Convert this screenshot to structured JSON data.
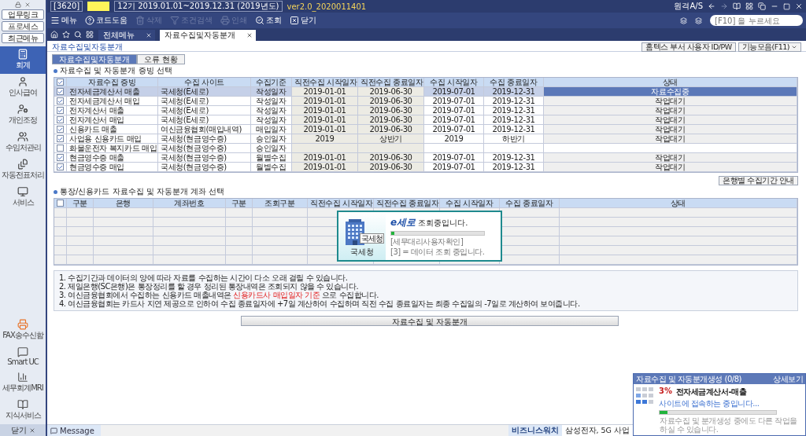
{
  "sidebar": {
    "top_buttons": [
      "업무링크",
      "프로세스",
      "최근메뉴"
    ],
    "items": [
      {
        "label": "회계",
        "selected": true
      },
      {
        "label": "인사급여",
        "selected": false
      },
      {
        "label": "개인조정",
        "selected": false
      },
      {
        "label": "수임처관리",
        "selected": false
      },
      {
        "label": "자동전표처리",
        "selected": false
      },
      {
        "label": "서비스",
        "selected": false
      }
    ],
    "bottom_items": [
      "FAX송수신함",
      "Smart UC",
      "세무회계MRI",
      "지식서비스"
    ],
    "close": "닫기"
  },
  "title_bar": {
    "code": "[3620]",
    "period": "12기 2019.01.01~2019.12.31 (2019년도)",
    "version": "ver2.0_2020011401",
    "remote": "원격A/S"
  },
  "toolbar": {
    "buttons": [
      {
        "label": "메뉴",
        "disabled": false
      },
      {
        "label": "코드도움",
        "disabled": false
      },
      {
        "label": "삭제",
        "disabled": true
      },
      {
        "label": "조건검색",
        "disabled": true
      },
      {
        "label": "인쇄",
        "disabled": true
      },
      {
        "label": "조회",
        "disabled": false
      },
      {
        "label": "닫기",
        "disabled": false
      }
    ],
    "search": {
      "placeholder": "[F10] 을 누르세요"
    }
  },
  "tabs": [
    {
      "label": "전체메뉴",
      "selected": false
    },
    {
      "label": "자료수집및자동분개",
      "selected": true
    }
  ],
  "page": {
    "title": "자료수집및자동분개",
    "buttons": [
      "홈텍스 부서 사용자 ID/PW",
      "기능모음(F11)"
    ]
  },
  "sub_tabs": [
    {
      "label": "자료수집및자동분개",
      "selected": true
    },
    {
      "label": "오류 현황",
      "selected": false
    }
  ],
  "evidence_section": {
    "title": "자료수집 및 자동분개 증빙 선택",
    "all_checked": true,
    "columns": [
      "자료수집 증빙",
      "수집 사이트",
      "수집기준",
      "직전수집 시작일자",
      "직전수집 종료일자",
      "수집 시작일자",
      "수집 종료일자",
      "상태"
    ],
    "rows": [
      {
        "checked": true,
        "selected": true,
        "evidence": "전자세금계산서 매출",
        "site": "국세청(E세로)",
        "basis": "작성일자",
        "prev_start": "2019-01-01",
        "prev_end": "2019-06-30",
        "start": "2019-07-01",
        "end": "2019-12-31",
        "status": "자료수집중"
      },
      {
        "checked": true,
        "selected": false,
        "evidence": "전자세금계산서 매입",
        "site": "국세청(E세로)",
        "basis": "작성일자",
        "prev_start": "2019-01-01",
        "prev_end": "2019-06-30",
        "start": "2019-07-01",
        "end": "2019-12-31",
        "status": "작업대기"
      },
      {
        "checked": true,
        "selected": false,
        "evidence": "전자계산서 매출",
        "site": "국세청(E세로)",
        "basis": "작성일자",
        "prev_start": "2019-01-01",
        "prev_end": "2019-06-30",
        "start": "2019-07-01",
        "end": "2019-12-31",
        "status": "작업대기"
      },
      {
        "checked": true,
        "selected": false,
        "evidence": "전자계산서 매입",
        "site": "국세청(E세로)",
        "basis": "작성일자",
        "prev_start": "2019-01-01",
        "prev_end": "2019-06-30",
        "start": "2019-07-01",
        "end": "2019-12-31",
        "status": "작업대기"
      },
      {
        "checked": true,
        "selected": false,
        "evidence": "신용카드 매출",
        "site": "여신금융협회(매입내역)",
        "basis": "매입일자",
        "prev_start": "2019-01-01",
        "prev_end": "2019-06-30",
        "start": "2019-07-01",
        "end": "2019-12-31",
        "status": "작업대기"
      },
      {
        "checked": true,
        "selected": false,
        "evidence": "사업용 신용카드 매입",
        "site": "국세청(현금영수증)",
        "basis": "승인일자",
        "prev_start": "2019",
        "prev_end": "상반기",
        "start": "2019",
        "end": "하반기",
        "status": "작업대기"
      },
      {
        "checked": false,
        "selected": false,
        "evidence": "화물운전자 복지카드 매입",
        "site": "국세청(현금영수증)",
        "basis": "승인일자"
      },
      {
        "checked": true,
        "selected": false,
        "evidence": "현금영수증 매출",
        "site": "국세청(현금영수증)",
        "basis": "월별수집",
        "prev_start": "2019-01-01",
        "prev_end": "2019-06-30",
        "start": "2019-07-01",
        "end": "2019-12-31",
        "status": "작업대기"
      },
      {
        "checked": true,
        "selected": false,
        "evidence": "현금영수증 매입",
        "site": "국세청(현금영수증)",
        "basis": "월별수집",
        "prev_start": "2019-01-01",
        "prev_end": "2019-06-30",
        "start": "2019-07-01",
        "end": "2019-12-31",
        "status": "작업대기"
      }
    ]
  },
  "bank_guide_button": "은행별 수집기간 안내",
  "account_section": {
    "title": "통장/신용카드 자료수집 및 자동분개 계좌 선택",
    "all_checked": false,
    "columns": [
      "구분",
      "은행",
      "계좌번호",
      "구분",
      "조회구분",
      "직전수집 시작일자",
      "직전수집 종료일자",
      "수집 시작일자",
      "수집 종료일자",
      "상태"
    ]
  },
  "loading_popup": {
    "building_label": "국세청",
    "sign": "국세청",
    "logo": "e세로",
    "message": "조회중입니다.",
    "level": 0.03,
    "lines": [
      "[세무대리사용자확인]",
      "[3] = 데이터 조회 중입니다."
    ]
  },
  "notes": [
    [
      {
        "text": "1. 수집기간과 데이터의 양에 따라 자료를 수집하는 시간이 다소 오래 걸릴 수 있습니다.",
        "highlight": false
      }
    ],
    [
      {
        "text": "2. 제일은행(SC은행)은 통장정리를 할 경우 정리된 통장내역은 조회되지 않을 수 있습니다.",
        "highlight": false
      }
    ],
    [
      {
        "text": "3. 여신금융협회에서 수집하는 신용카드 매출내역은 ",
        "highlight": false
      },
      {
        "text": "신용카드사 매입일자 기준",
        "highlight": true
      },
      {
        "text": " 으로 수집합니다.",
        "highlight": false
      }
    ],
    [
      {
        "text": "4. 여신금융협회는 카드사 지연 제공으로 인하여 수집 종료일자에 +7일 계산하여 수집하며 직전 수집 종료일자는 최종 수집일의 -7일로 계산하여 보여줍니다.",
        "highlight": false
      }
    ]
  ],
  "main_button": "자료수집 및 자동분개",
  "status_bar": {
    "message_tab": "Message",
    "news_label": "비즈니스워치",
    "news": "삼성전자, 5G 사업"
  },
  "progress_popup": {
    "title": "자료수집 및 자동분개생성 (0/8)",
    "detail_link": "상세보기",
    "percent": "3%",
    "item": "전자세금계산서-매출",
    "message": "사이트에 접속하는 중입니다...",
    "level": 0.07,
    "footnote": "자료수집 및 분개생성 중에도 다른 작업을 하실 수 있습니다."
  }
}
